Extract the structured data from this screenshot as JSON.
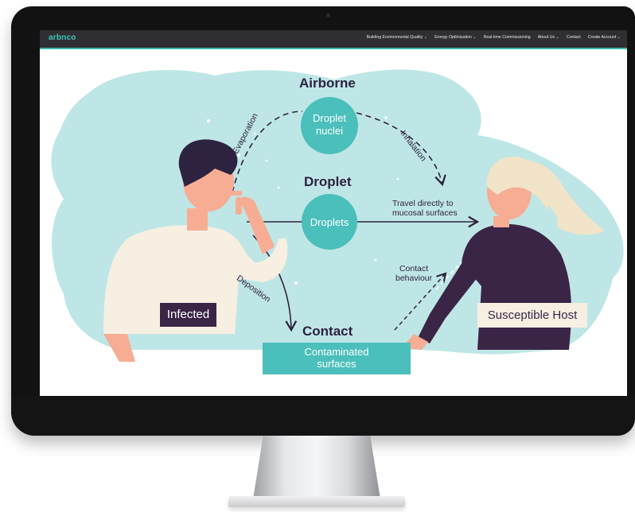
{
  "nav": {
    "logo": "arbnco",
    "items": [
      {
        "label": "Building Environmental Quality ⌄"
      },
      {
        "label": "Energy Optimization ⌄"
      },
      {
        "label": "Real-time Commissioning"
      },
      {
        "label": "About Us ⌄"
      },
      {
        "label": "Contact"
      },
      {
        "label": "Create Account ⌄"
      }
    ]
  },
  "diagram": {
    "airborne": "Airborne",
    "droplet_nuclei_1": "Droplet",
    "droplet_nuclei_2": "nuclei",
    "droplet": "Droplet",
    "droplets": "Droplets",
    "contact": "Contact",
    "evaporation": "Evaporation",
    "inhalation": "Inhalation",
    "travel_1": "Travel directly to",
    "travel_2": "mucosal surfaces",
    "deposition": "Deposition",
    "contact_behaviour_1": "Contact",
    "contact_behaviour_2": "behaviour",
    "infected": "Infected",
    "susceptible_host": "Susceptible Host",
    "surfaces_1": "Contaminated",
    "surfaces_2": "surfaces"
  },
  "colors": {
    "teal_bg": "#bfe6e6",
    "teal_circle": "#4bbfbb",
    "dark_purple": "#3a2547",
    "skin": "#f6ad94"
  }
}
